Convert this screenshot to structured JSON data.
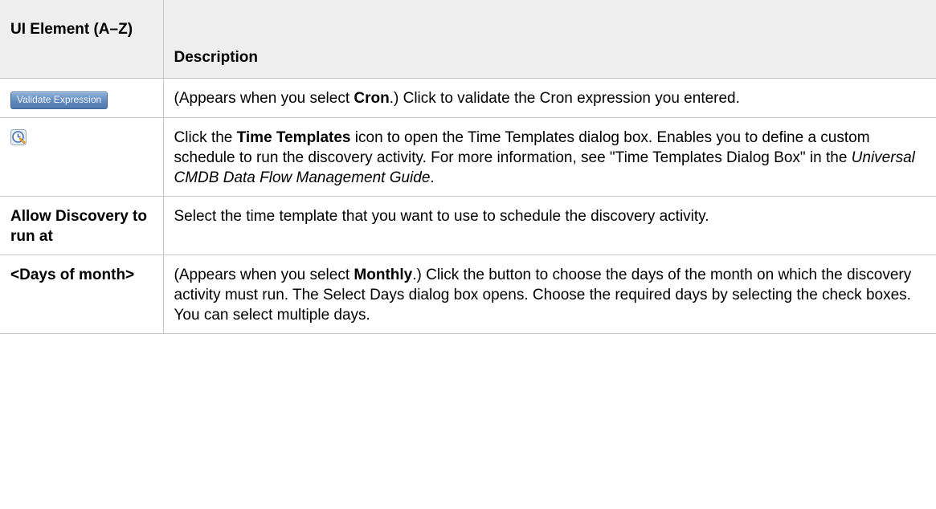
{
  "header": {
    "col1": "UI Element (A–Z)",
    "col2": "Description"
  },
  "rows": [
    {
      "element": {
        "type": "button",
        "label": "Validate Expression"
      },
      "desc": {
        "p1": "(Appears when you select ",
        "b1": "Cron",
        "p2": ".) Click to validate the Cron expression you entered."
      }
    },
    {
      "element": {
        "type": "icon",
        "icon": "time-templates-icon"
      },
      "desc": {
        "p1": "Click the ",
        "b1": "Time Templates",
        "p2": " icon to open the Time Templates dialog box. Enables you to define a custom schedule to run the discovery activity. For more information, see \"Time Templates Dialog Box\" in the ",
        "i1": "Universal CMDB Data Flow Management Guide",
        "p3": "."
      }
    },
    {
      "element": {
        "type": "text",
        "label": "Allow Discovery to run at"
      },
      "desc": {
        "p1": "Select the time template that you want to use to schedule the discovery activity."
      }
    },
    {
      "element": {
        "type": "text",
        "label": "<Days of month>"
      },
      "desc": {
        "p1": "(Appears when you select ",
        "b1": "Monthly",
        "p2": ".) Click the button to choose the days of the month on which the discovery activity must run. The Select Days dialog box opens. Choose the required days by selecting the check boxes. You can select multiple days."
      }
    }
  ]
}
